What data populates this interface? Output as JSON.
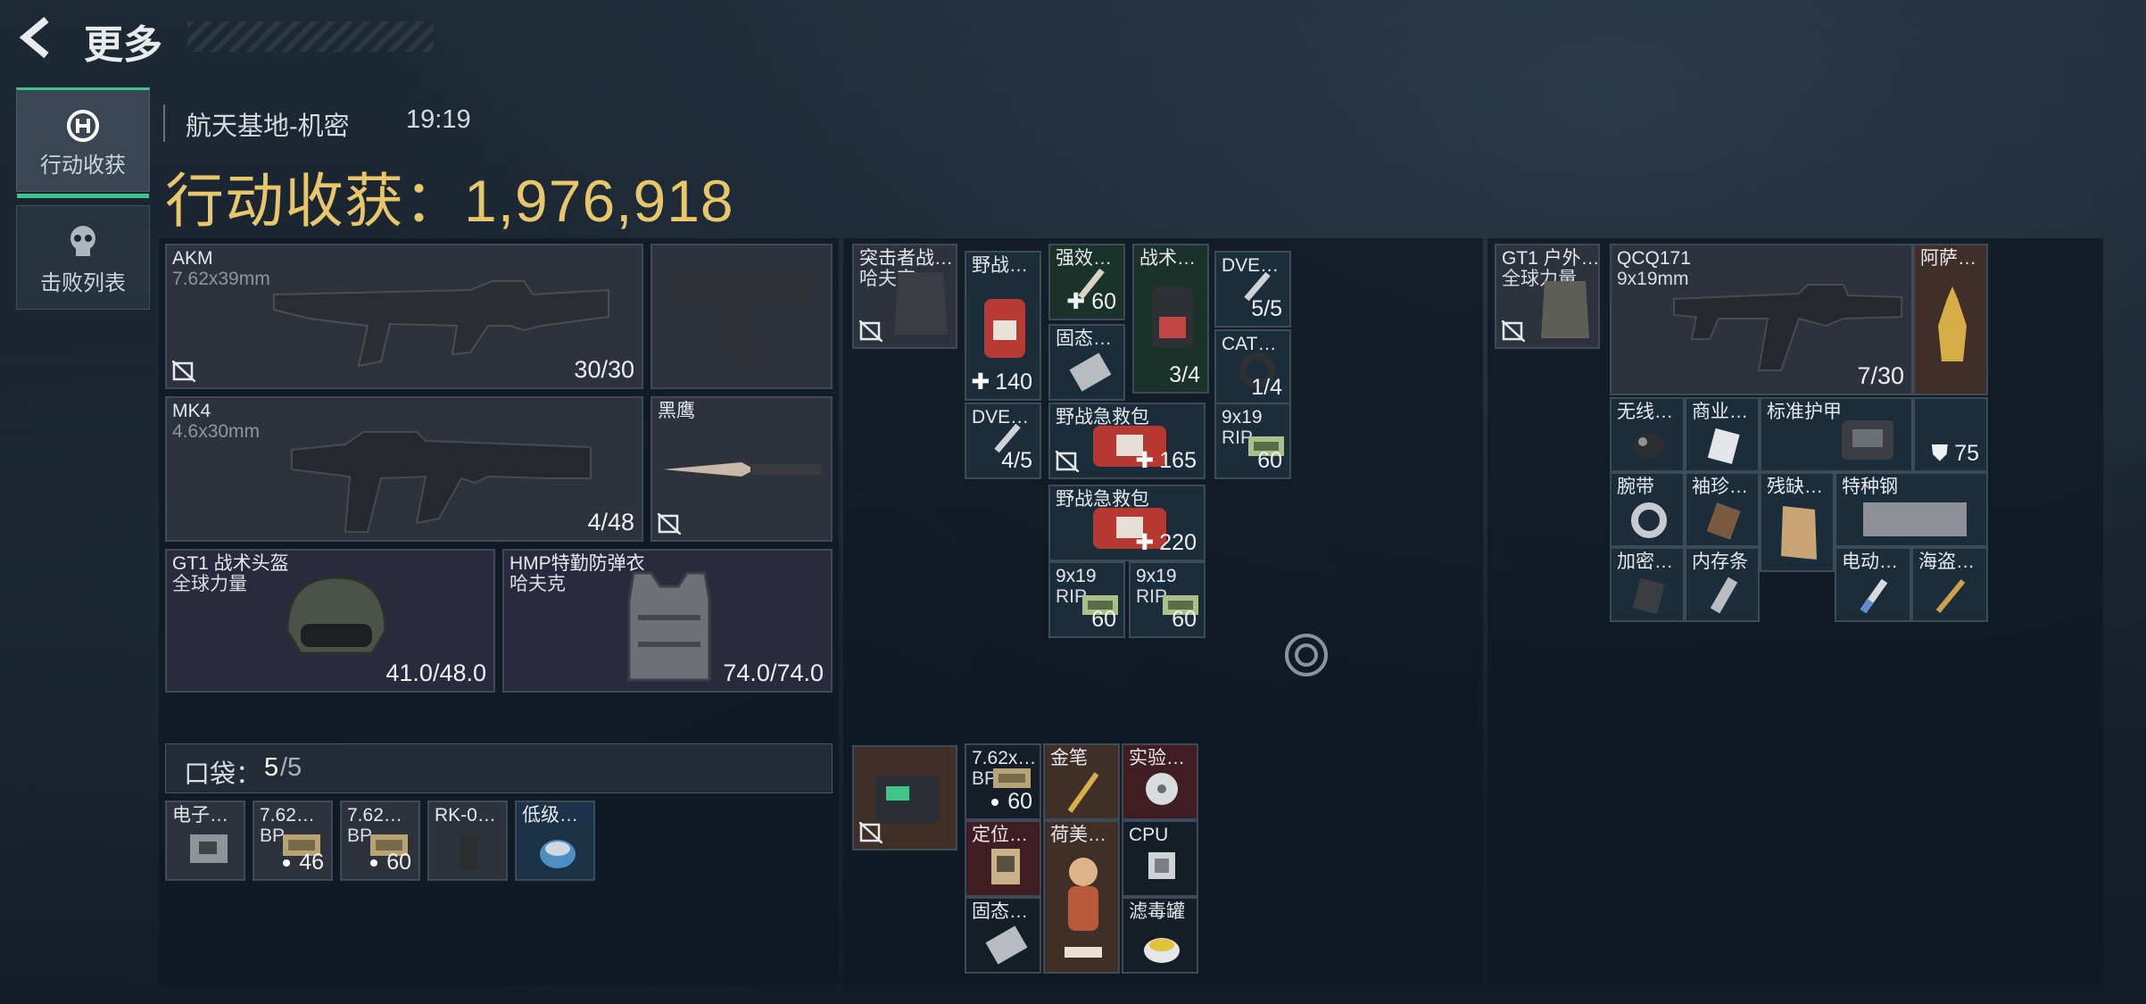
{
  "header": {
    "title": "更多"
  },
  "tabs": [
    {
      "label": "行动收获",
      "icon": "loot-icon",
      "active": true
    },
    {
      "label": "击败列表",
      "icon": "skull-icon",
      "active": false
    }
  ],
  "raid": {
    "map": "航天基地-机密",
    "time": "19:19",
    "loot_label": "行动收获：",
    "loot_value": "1,976,918"
  },
  "weapons": {
    "primary1": {
      "name": "AKM",
      "caliber": "7.62x39mm",
      "ammo": "30/30"
    },
    "primary2": {
      "name": "MK4",
      "caliber": "4.6x30mm",
      "ammo": "4/48"
    },
    "melee": {
      "name": "黑鹰"
    },
    "helmet": {
      "name": "GT1 战术头盔",
      "brand": "全球力量",
      "durability": "41.0/48.0"
    },
    "armor": {
      "name": "HMP特勤防弹衣",
      "brand": "哈夫克",
      "durability": "74.0/74.0"
    }
  },
  "pockets": {
    "label": "口袋：",
    "used": "5",
    "capacity": "/5",
    "items": [
      {
        "name": "电子…"
      },
      {
        "name": "7.62…",
        "sub": "BP",
        "count": "46"
      },
      {
        "name": "7.62…",
        "sub": "BP",
        "count": "60"
      },
      {
        "name": "RK-0…"
      },
      {
        "name": "低级…"
      }
    ]
  },
  "chest_rig": {
    "name": "突击者战…",
    "brand": "哈夫克",
    "items": {
      "med1": {
        "name": "野战…",
        "count": "140"
      },
      "inj": {
        "name": "强效…",
        "count": "60"
      },
      "tac": {
        "name": "战术…",
        "count": "3/4"
      },
      "dve1": {
        "name": "DVE…",
        "count": "5/5"
      },
      "ssd1": {
        "name": "固态…"
      },
      "cat": {
        "name": "CAT…",
        "count": "1/4"
      },
      "dve2": {
        "name": "DVE…",
        "count": "4/5"
      },
      "med2": {
        "name": "野战急救包",
        "count": "165"
      },
      "ammo1": {
        "name": "9x19",
        "sub": "RIP",
        "count": "60"
      },
      "med3": {
        "name": "野战急救包",
        "count": "220"
      },
      "ammo2": {
        "name": "9x19",
        "sub": "RIP",
        "count": "60"
      },
      "ammo3": {
        "name": "9x19",
        "sub": "RIP",
        "count": "60"
      }
    }
  },
  "backpack": {
    "items": {
      "b1": {
        "name": "7.62x…",
        "sub": "BP",
        "count": "60"
      },
      "b2": {
        "name": "金笔"
      },
      "b3": {
        "name": "实验…"
      },
      "b4": {
        "name": "定位…"
      },
      "b5": {
        "name": "荷美…"
      },
      "b6": {
        "name": "CPU"
      },
      "b7": {
        "name": "固态…"
      },
      "b8": {
        "name": "滤毒罐"
      }
    }
  },
  "secure": {
    "bag": {
      "name": "GT1 户外…",
      "brand": "全球力量"
    },
    "smg": {
      "name": "QCQ171",
      "caliber": "9x19mm",
      "ammo": "7/30"
    },
    "items": {
      "s1": {
        "name": "阿萨…"
      },
      "s2": {
        "name": "无线…"
      },
      "s3": {
        "name": "商业…"
      },
      "s4": {
        "name": "标准护甲",
        "count": "75"
      },
      "s5": {
        "name": "腕带"
      },
      "s6": {
        "name": "袖珍…"
      },
      "s7": {
        "name": "残缺…"
      },
      "s8": {
        "name": "特种钢"
      },
      "s9": {
        "name": "加密…"
      },
      "s10": {
        "name": "内存条"
      },
      "s11": {
        "name": "电动…"
      },
      "s12": {
        "name": "海盗…"
      }
    }
  },
  "colors": {
    "accent_green": "#3fc58a",
    "loot_gold": "#e8c66a"
  }
}
